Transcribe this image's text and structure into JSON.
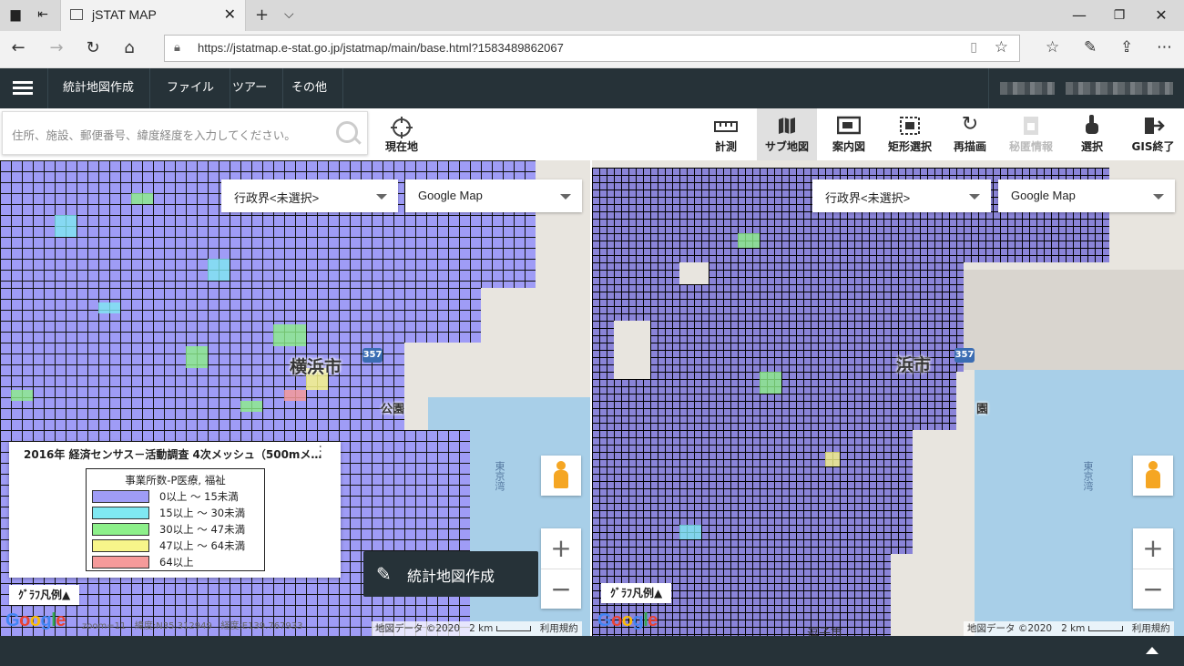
{
  "browser": {
    "tab_title": "jSTAT MAP",
    "url": "https://jstatmap.e-stat.go.jp/jstatmap/main/base.html?1583489862067"
  },
  "app_menu": [
    "統計地図作成",
    "ファイル",
    "ツアー",
    "その他"
  ],
  "search": {
    "placeholder": "住所、施設、郵便番号、緯度経度を入力してください。"
  },
  "toolbar": {
    "current_location": "現在地",
    "tools": [
      {
        "label": "計測",
        "state": "normal"
      },
      {
        "label": "サブ地図",
        "state": "active"
      },
      {
        "label": "案内図",
        "state": "normal"
      },
      {
        "label": "矩形選択",
        "state": "normal"
      },
      {
        "label": "再描画",
        "state": "normal"
      },
      {
        "label": "秘匿情報",
        "state": "disabled"
      },
      {
        "label": "選択",
        "state": "normal"
      },
      {
        "label": "GIS終了",
        "state": "normal"
      }
    ]
  },
  "left_map": {
    "boundary_select": "行政界<未選択>",
    "basemap_select": "Google Map",
    "city_label": "横浜市",
    "park_label": "公園",
    "route": "357",
    "bay_label": "東京湾",
    "graph_legend_button": "ｸﾞﾗﾌ凡例▲",
    "status": {
      "zoom": "zoom=11",
      "lat": "緯度:N35.312949",
      "lon": "経度:E139.767933"
    },
    "map_data": "地図データ ©2020",
    "scale": "2 km",
    "terms": "利用規約"
  },
  "right_map": {
    "boundary_select": "行政界<未選択>",
    "basemap_select": "Google Map",
    "city_label": "浜市",
    "park_label": "園",
    "route": "357",
    "bay_label": "東京湾",
    "bottom_city": "逗子市",
    "graph_legend_button": "ｸﾞﾗﾌ凡例▲",
    "map_data": "地図データ ©2020",
    "scale": "2 km",
    "terms": "利用規約"
  },
  "legend": {
    "title": "2016年 経済センサス－活動調査 4次メッシュ（500mメ…",
    "box_title": "事業所数-P医療, 福祉",
    "items": [
      {
        "label": "0以上 ～ 15未満",
        "color": "#9f9cf6"
      },
      {
        "label": "15以上 ～ 30未満",
        "color": "#7fe8f2"
      },
      {
        "label": "30以上 ～ 47未満",
        "color": "#8df08a"
      },
      {
        "label": "47以上 ～ 64未満",
        "color": "#f7f58a"
      },
      {
        "label": "64以上",
        "color": "#f59a9a"
      }
    ]
  },
  "create_button": "統計地図作成",
  "google_logo": "Google"
}
